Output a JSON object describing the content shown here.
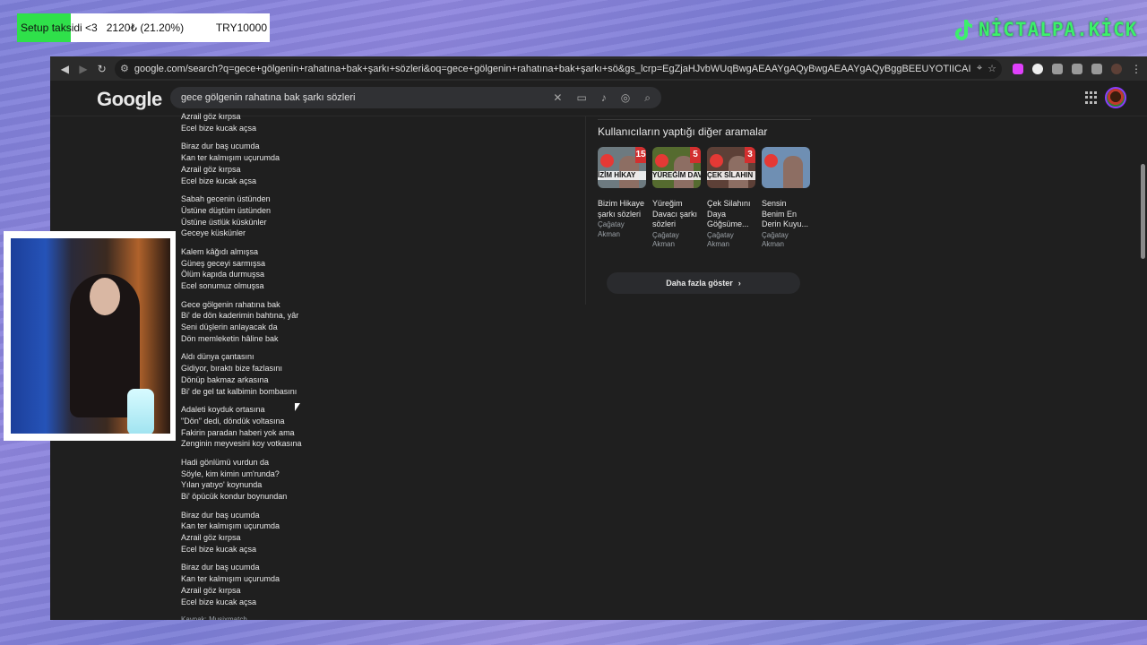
{
  "donation": {
    "label": "Setup taksidi <3",
    "amount": "2120₺ (21.20%)",
    "target": "TRY10000",
    "progress": 0.212
  },
  "brand": {
    "name": "NİCTALPA.KİCK",
    "icon": "tiktok-note-icon",
    "color": "#3cf06a"
  },
  "browser": {
    "url": "google.com/search?q=gece+gölgenin+rahatına+bak+şarkı+sözleri&oq=gece+gölgenin+rahatına+bak+şarkı+sö&gs_lcrp=EgZjaHJvbWUqBwgAEAAYgAQyBwgAEAAYgAQyBggBEEUYOTIICAIQABgWGB4yCAgDEAAYFhgeMgcIB..."
  },
  "google": {
    "logo": "Google",
    "query": "gece gölgenin rahatına bak şarkı sözleri"
  },
  "lyrics": {
    "stanzas": [
      [
        "Azrail göz kırpsa",
        "Ecel bize kucak açsa"
      ],
      [
        "Biraz dur baş ucumda",
        "Kan ter kalmışım uçurumda",
        "Azrail göz kırpsa",
        "Ecel bize kucak açsa"
      ],
      [
        "Sabah gecenin üstünden",
        "Üstüne düştüm üstünden",
        "Üstüne üstlük küskünler",
        "Geceye küskünler"
      ],
      [
        "Kalem kâğıdı almışsa",
        "Güneş geceyi sarmışsa",
        "Ölüm kapıda durmuşsa",
        "Ecel sonumuz olmuşsa"
      ],
      [
        "Gece gölgenin rahatına bak",
        "Bi' de dön kaderimin bahtına, yâr",
        "Seni düşlerin anlayacak da",
        "Dön memleketin hâline bak"
      ],
      [
        "Aldı dünya çantasını",
        "Gidiyor, bıraktı bize fazlasını",
        "Dönüp bakmaz arkasına",
        "Bi' de gel tat kalbimin bombasını"
      ],
      [
        "Adaleti koyduk ortasına",
        "\"Dön\" dedi, döndük voltasına",
        "Fakirin paradan haberi yok ama",
        "Zenginin meyvesini koy votkasına"
      ],
      [
        "Hadi gönlümü vurdun da",
        "Söyle, kim kimin um'runda?",
        "Yılan yatıyo' koynunda",
        "Bi' öpücük kondur boynundan"
      ],
      [
        "Biraz dur baş ucumda",
        "Kan ter kalmışım uçurumda",
        "Azrail göz kırpsa",
        "Ecel bize kucak açsa"
      ],
      [
        "Biraz dur baş ucumda",
        "Kan ter kalmışım uçurumda",
        "Azrail göz kırpsa",
        "Ecel bize kucak açsa"
      ]
    ],
    "source": "Kaynak: Musixmatch"
  },
  "related": {
    "title": "Kullanıcıların yaptığı diğer aramalar",
    "items": [
      {
        "title": "Bizim Hikaye şarkı sözleri",
        "artist": "Çağatay Akman",
        "thumb_text": "İZİM HİKAY",
        "thumb_num": "15",
        "thumb_bg": "#6d7a80"
      },
      {
        "title": "Yüreğim Davacı şarkı sözleri",
        "artist": "Çağatay Akman",
        "thumb_text": "YÜREĞİM DAV",
        "thumb_num": "5",
        "thumb_bg": "#556b2f"
      },
      {
        "title": "Çek Silahını Daya Göğsüme...",
        "artist": "Çağatay Akman",
        "thumb_text": "ÇEK SİLAHIN",
        "thumb_num": "3",
        "thumb_bg": "#5d4037"
      },
      {
        "title": "Sensin Benim En Derin Kuyu...",
        "artist": "Çağatay Akman",
        "thumb_text": "",
        "thumb_num": "",
        "thumb_bg": "#6f8fb3"
      }
    ],
    "more_label": "Daha fazla göster"
  }
}
